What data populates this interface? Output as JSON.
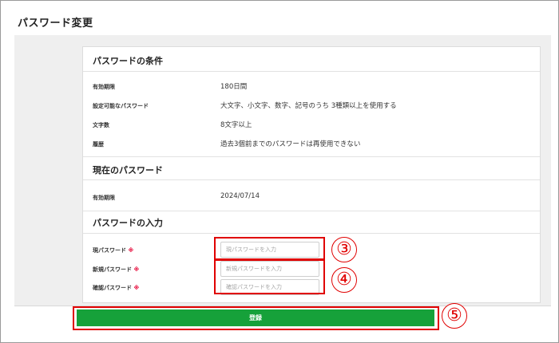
{
  "page": {
    "title": "パスワード変更"
  },
  "conditions": {
    "title": "パスワードの条件",
    "rows": [
      {
        "label": "有効期限",
        "value": "180日間"
      },
      {
        "label": "設定可能なパスワード",
        "value": "大文字、小文字、数字、記号のうち 3種類以上を使用する"
      },
      {
        "label": "文字数",
        "value": "8文字以上"
      },
      {
        "label": "履歴",
        "value": "過去3個前までのパスワードは再使用できない"
      }
    ]
  },
  "current": {
    "title": "現在のパスワード",
    "rows": [
      {
        "label": "有効期限",
        "value": "2024/07/14"
      }
    ]
  },
  "input": {
    "title": "パスワードの入力",
    "required_mark": "※",
    "fields": [
      {
        "label": "現パスワード",
        "placeholder": "現パスワードを入力",
        "value": ""
      },
      {
        "label": "新規パスワード",
        "placeholder": "新規パスワードを入力",
        "value": ""
      },
      {
        "label": "確認パスワード",
        "placeholder": "確認パスワードを入力",
        "value": ""
      }
    ]
  },
  "submit": {
    "label": "登録",
    "color": "#16a13a"
  },
  "annotations": [
    "③",
    "④",
    "⑤"
  ],
  "colors": {
    "annotation": "#e00000",
    "required": "#e60033"
  }
}
